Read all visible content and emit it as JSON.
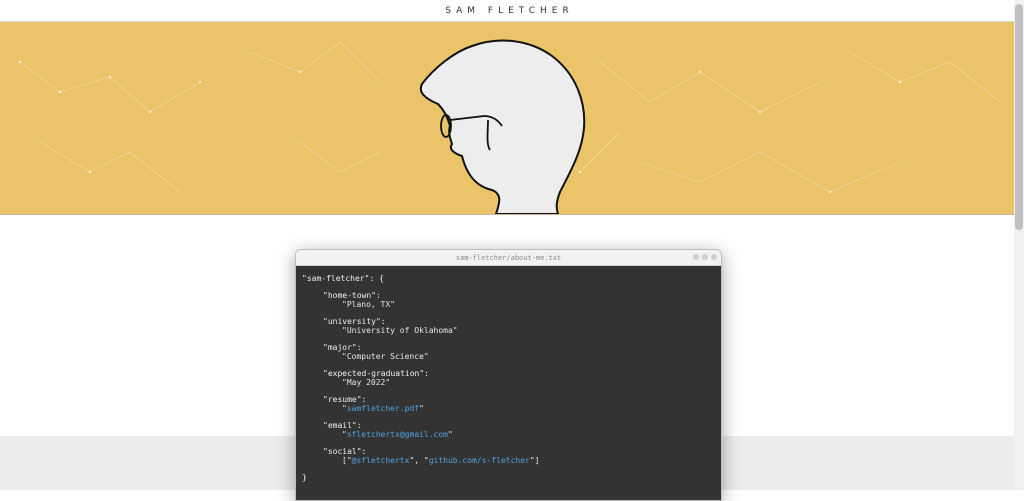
{
  "header": {
    "title": "SAM FLETCHER"
  },
  "colors": {
    "banner": "#ebc46a",
    "terminal_bg": "#333333",
    "link": "#4fa3e0"
  },
  "window": {
    "title": "sam-fletcher/about-me.txt",
    "root_key": "\"sam-fletcher\": {",
    "closing": "}",
    "fields": {
      "home_town_key": "\"home-town\":",
      "home_town_val": "\"Plano, TX\"",
      "university_key": "\"university\":",
      "university_val": "\"University of Oklahoma\"",
      "major_key": "\"major\":",
      "major_val": "\"Computer Science\"",
      "graduation_key": "\"expected-graduation\":",
      "graduation_val": "\"May 2022\"",
      "resume_key": "\"resume\":",
      "resume_link": "samfletcher.pdf",
      "email_key": "\"email\":",
      "email_link": "sfletchertx@gmail.com",
      "social_key": "\"social\":",
      "social_link_1": "@sfletchertx",
      "social_link_2": "github.com/s-fletcher"
    }
  },
  "icons": {
    "avatar": "silhouette-with-glasses"
  }
}
